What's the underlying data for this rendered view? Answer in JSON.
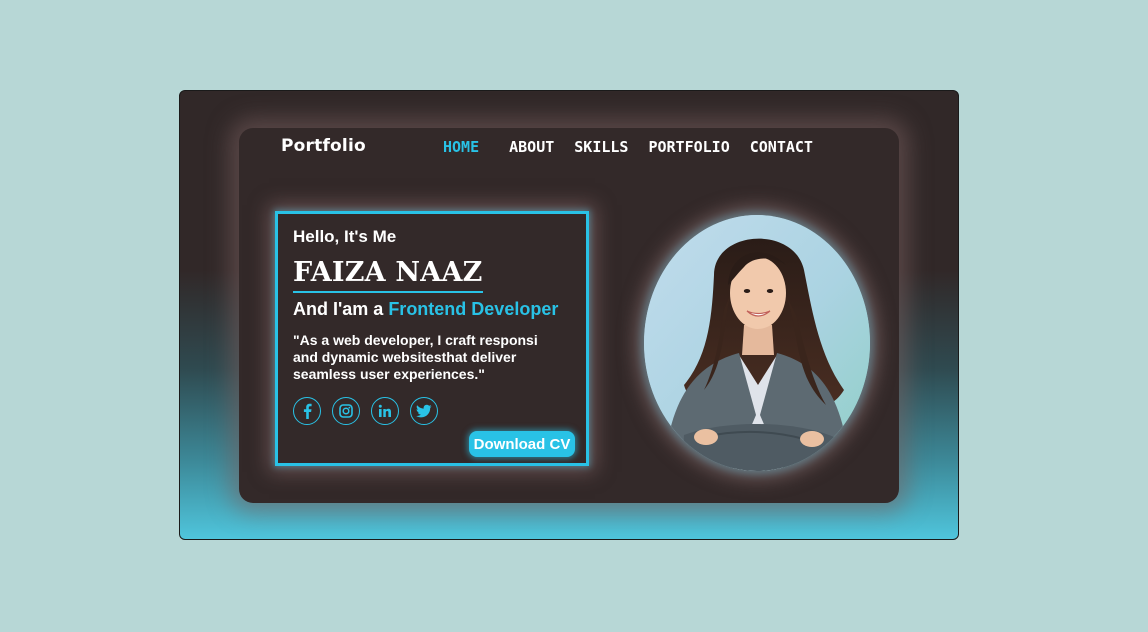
{
  "header": {
    "logo": "Portfolio",
    "nav": [
      {
        "label": "HOME",
        "active": true
      },
      {
        "label": "ABOUT",
        "active": false
      },
      {
        "label": "SKILLS",
        "active": false
      },
      {
        "label": "PORTFOLIO",
        "active": false
      },
      {
        "label": "CONTACT",
        "active": false
      }
    ]
  },
  "intro": {
    "greeting": "Hello, It's Me",
    "name": "FAIZA NAAZ",
    "role_prefix": "And I'am a ",
    "role_highlight": "Frontend Developer",
    "quote_line1": "\"As a web developer, I craft responsi",
    "quote_line2": "and dynamic websitesthat deliver",
    "quote_line3": "seamless user experiences.\"",
    "download_label": "Download CV"
  },
  "socials": [
    {
      "icon": "facebook-icon"
    },
    {
      "icon": "instagram-icon"
    },
    {
      "icon": "linkedin-icon"
    },
    {
      "icon": "twitter-icon"
    }
  ],
  "colors": {
    "accent": "#29c2e6",
    "card_bg": "#332929",
    "page_bg": "#b7d7d6"
  }
}
